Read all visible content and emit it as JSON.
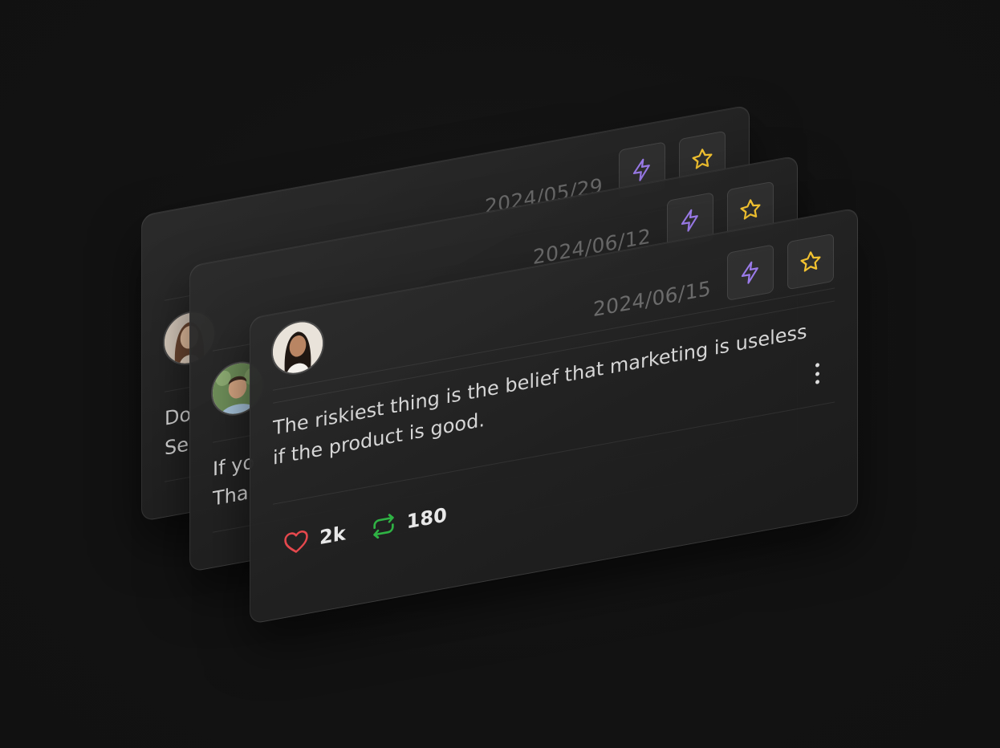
{
  "cards": [
    {
      "date": "2024/05/29",
      "text": "Do\nSe",
      "avatar": "woman-avatar-1",
      "likes_icon": "heart-icon"
    },
    {
      "date": "2024/06/12",
      "text": "If yo\nTha",
      "avatar": "man-avatar",
      "likes_icon": "heart-icon"
    },
    {
      "date": "2024/06/15",
      "text": "The riskiest thing is the belief that marketing is useless\nif the product is good.",
      "avatar": "woman-avatar-2",
      "likes": "2k",
      "reposts": "180"
    }
  ],
  "icons": {
    "bolt": "lightning-bolt-icon",
    "star": "star-icon",
    "more": "more-vertical-icon",
    "like": "heart-icon",
    "repost": "repost-icon"
  },
  "colors": {
    "background": "#121212",
    "bolt": "#9b7bea",
    "star": "#f2c230",
    "heart": "#e5484d",
    "repost": "#2fb344"
  }
}
